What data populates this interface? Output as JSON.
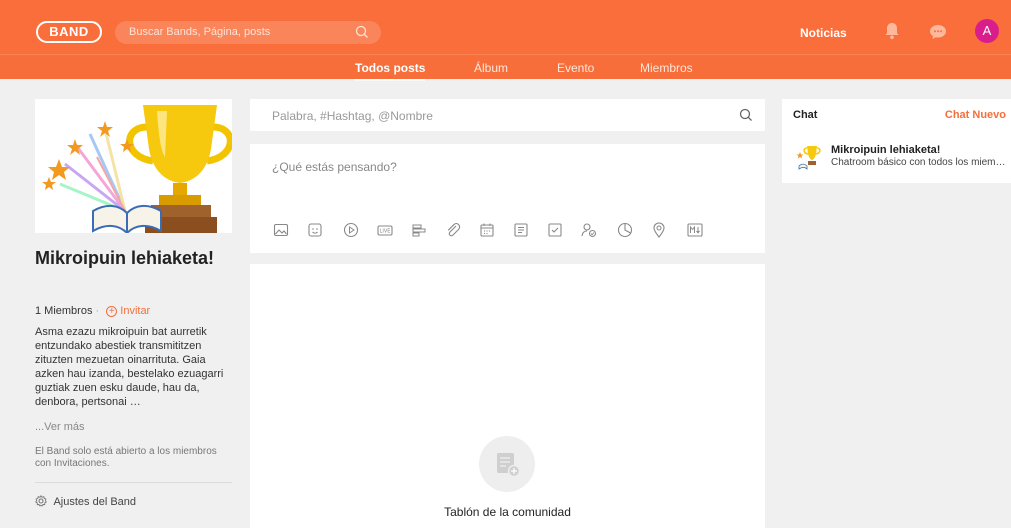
{
  "header": {
    "logo": "BAND",
    "search_placeholder": "Buscar Bands, Página, posts",
    "news_label": "Noticias",
    "avatar_initial": "A"
  },
  "nav": {
    "tabs": [
      {
        "label": "Todos posts",
        "active": true
      },
      {
        "label": "Álbum",
        "active": false
      },
      {
        "label": "Evento",
        "active": false
      },
      {
        "label": "Miembros",
        "active": false
      }
    ]
  },
  "band": {
    "name": "Mikroipuin lehiaketa!",
    "members": "1 Miembros",
    "invite_label": "Invitar",
    "description": "Asma ezazu mikroipuin bat aurretik entzundako abestiek transmititzen zituzten mezuetan oinarrituta. Gaia azken hau izanda, bestelako ezuagarri guztiak zuen esku daude, hau da, denbora, pertsonai …",
    "see_more": "...Ver más",
    "closed_note": "El Band solo está abierto a los miembros con Invitaciones.",
    "settings_label": "Ajustes del Band"
  },
  "feed": {
    "search_placeholder": "Palabra, #Hashtag, @Nombre",
    "composer_placeholder": "¿Qué estás pensando?",
    "empty_title": "Tablón de la comunidad"
  },
  "chat": {
    "title": "Chat",
    "new_label": "Chat Nuevo",
    "rooms": [
      {
        "name": "Mikroipuin lehiaketa!",
        "preview": "Chatroom básico con todos los miembros"
      }
    ]
  },
  "colors": {
    "brand": "#fa6e3c",
    "accent_text": "#f36f3c",
    "avatar": "#d91e8c"
  }
}
